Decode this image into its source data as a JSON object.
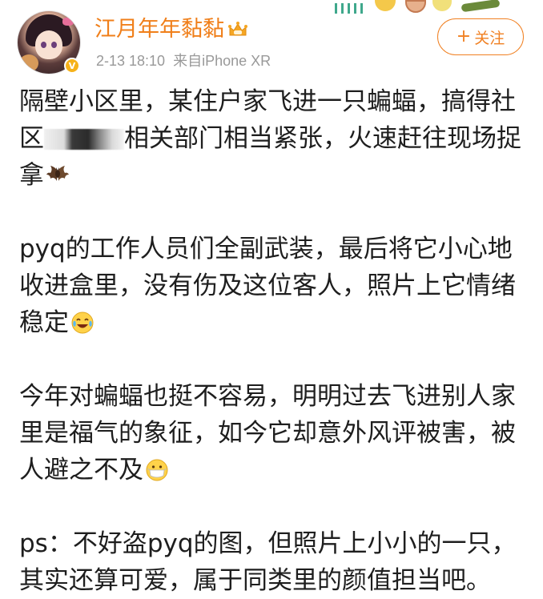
{
  "post": {
    "author": {
      "name": "江月年年黏黏",
      "verified": true,
      "vip_icon": "crown-icon"
    },
    "meta": {
      "time": "2-13 18:10",
      "source": "来自iPhone XR"
    },
    "follow_button": {
      "label": "关注",
      "plus": "+"
    },
    "paragraphs": [
      {
        "lines": [
          "隔壁小区里，某住户家飞进一只蝙蝠，搞得社",
          {
            "before": "区",
            "after": "相关部门相当紧张，火速赶往现场捉"
          },
          {
            "text": "拿",
            "emoji": "bat-icon"
          }
        ]
      },
      {
        "lines": [
          "pyq的工作人员们全副武装，最后将它小心地",
          "收进盒里，没有伤及这位客人，照片上它情绪",
          {
            "text": "稳定",
            "emoji": "laugh-cry-icon"
          }
        ]
      },
      {
        "lines": [
          "今年对蝙蝠也挺不容易，明明过去飞进别人家",
          "里是福气的象征，如今它却意外风评被害，被",
          {
            "text": "人避之不及",
            "emoji": "mask-face-icon"
          }
        ]
      },
      {
        "lines": [
          "ps：不好盗pyq的图，但照片上小小的一只，",
          "其实还算可爱，属于同类里的颜值担当吧。"
        ]
      }
    ]
  },
  "colors": {
    "username": "#f07f1a",
    "follow_border": "#f08022",
    "meta": "#999999",
    "body_text": "#1e1e1e"
  }
}
